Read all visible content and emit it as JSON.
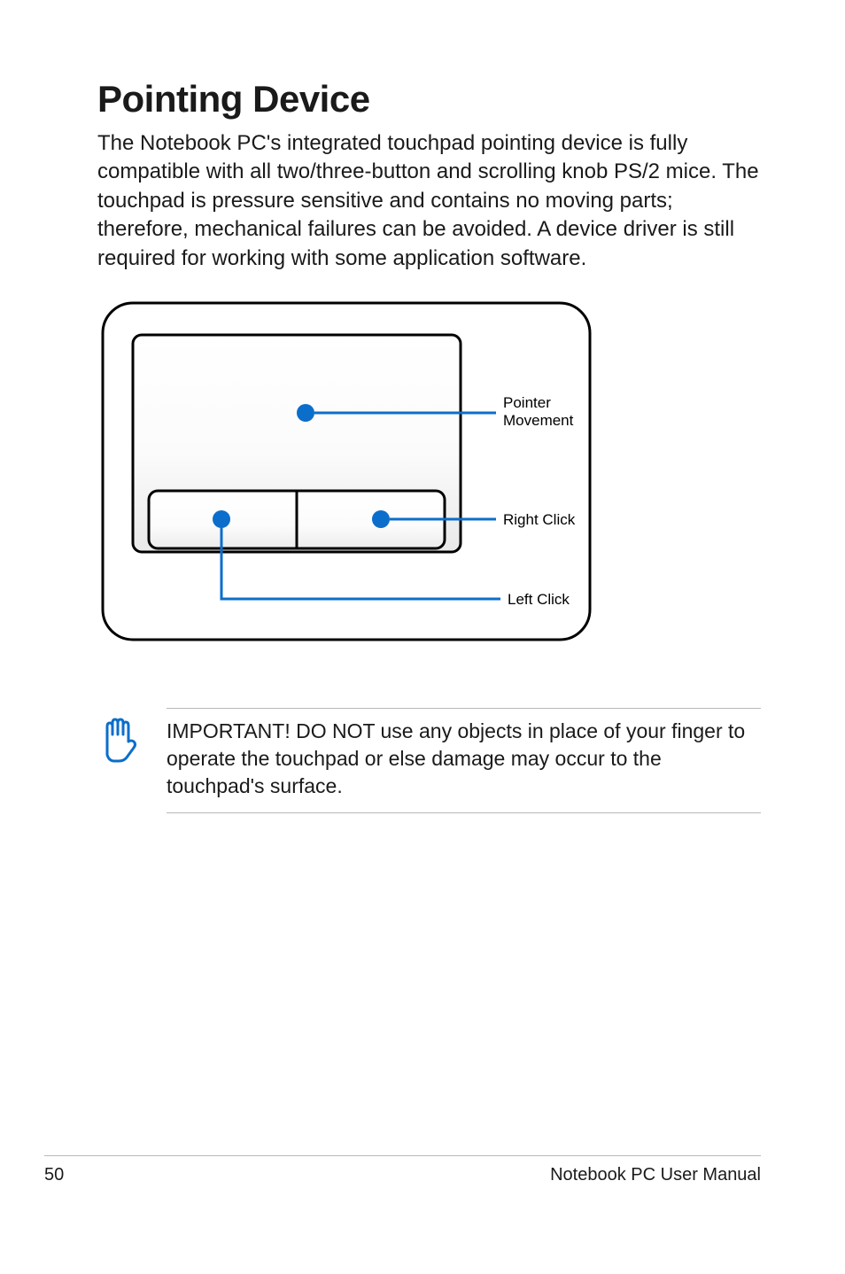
{
  "title": "Pointing Device",
  "intro": "The Notebook PC's integrated touchpad pointing device is fully compatible with all two/three-button and scrolling knob PS/2 mice. The touchpad is pressure sensitive and contains no moving parts; therefore, mechanical failures can be avoided. A device driver is still required for working with some application software.",
  "diagram": {
    "labels": {
      "pointer_movement_line1": "Pointer",
      "pointer_movement_line2": "Movement",
      "right_click": "Right Click",
      "left_click": "Left Click"
    }
  },
  "note": {
    "text": "IMPORTANT! DO NOT use any objects in place of your finger to operate the touchpad or else damage may occur to the touchpad's surface."
  },
  "footer": {
    "page_number": "50",
    "manual_title": "Notebook PC User Manual"
  }
}
